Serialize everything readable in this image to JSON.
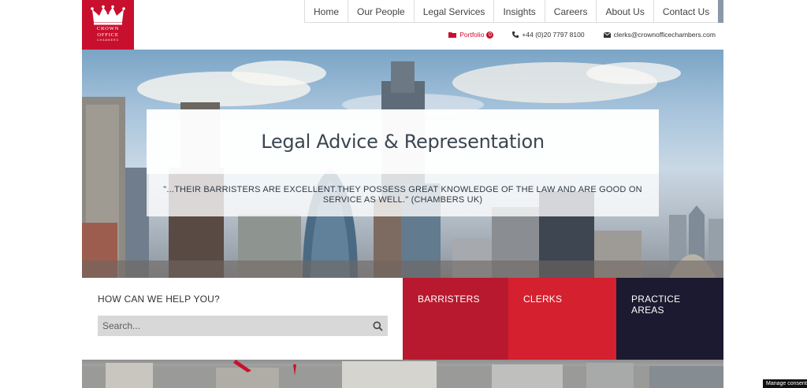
{
  "logo": {
    "line1": "CROWN",
    "line2": "OFFICE",
    "line3": "CHAMBERS",
    "icon": "crown-icon"
  },
  "nav": {
    "items": [
      "Home",
      "Our People",
      "Legal Services",
      "Insights",
      "Careers",
      "About Us",
      "Contact Us"
    ],
    "search_icon": "search-icon"
  },
  "utility": {
    "portfolio_label": "Portfolio",
    "portfolio_count": "0",
    "phone": "+44 (0)20 7797 8100",
    "email": "clerks@crownofficechambers.com"
  },
  "hero": {
    "title": "Legal Advice & Representation",
    "quote": "\"...THEIR BARRISTERS ARE EXCELLENT.THEY POSSESS GREAT KNOWLEDGE OF THE LAW AND ARE GOOD ON SERVICE AS WELL.\" (CHAMBERS UK)"
  },
  "help": {
    "title": "HOW CAN WE HELP YOU?",
    "search_placeholder": "Search..."
  },
  "tiles": {
    "barristers": "BARRISTERS",
    "clerks": "CLERKS",
    "practice_areas": "PRACTICE AREAS"
  },
  "cookie": {
    "label": "Manage consent"
  },
  "colors": {
    "brand_red": "#c8102e",
    "dark_navy": "#1b1a30",
    "nav_search_bg": "#8a98a8"
  }
}
